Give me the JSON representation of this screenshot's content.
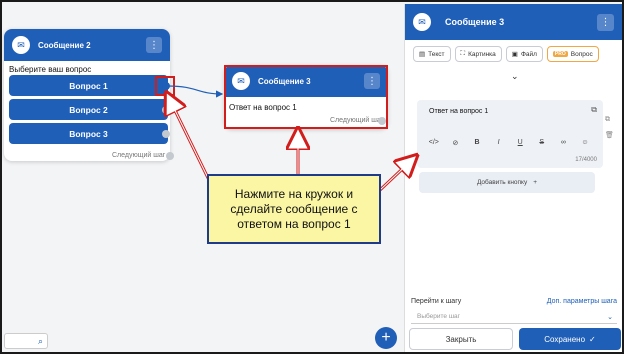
{
  "flow": {
    "card2": {
      "title": "Сообщение 2",
      "question": "Выберите ваш вопрос",
      "buttons": [
        "Вопрос 1",
        "Вопрос 2",
        "Вопрос 3"
      ],
      "next_step": "Следующий шаг"
    },
    "card3": {
      "title": "Сообщение 3",
      "text": "Ответ на вопрос 1",
      "next_step": "Следующий шаг"
    }
  },
  "callout": {
    "text": "Нажмите на кружок и сделайте сообщение с ответом на вопрос 1"
  },
  "panel": {
    "title": "Сообщение 3",
    "types": [
      "Текст",
      "Картинка",
      "Файл",
      "Вопрос"
    ],
    "pro_badge": "PRO",
    "editor_text": "Ответ на вопрос 1",
    "counter": "17/4000",
    "add_button": "Добавить кнопку",
    "goto_label": "Перейти к шагу",
    "goto_link": "Доп. параметры шага",
    "goto_placeholder": "Выберите шаг",
    "close_label": "Закрыть",
    "saved_label": "Сохранено"
  },
  "icons": {
    "avatar": "message-icon",
    "more": "more-vertical-icon",
    "search": "search-icon",
    "fab": "plus-icon"
  },
  "colors": {
    "primary": "#1f5fb8",
    "annotation_red": "#d21d1d",
    "callout_bg": "#fbf6a4",
    "callout_border": "#1e3a8a",
    "pro_orange": "#f0a845"
  }
}
